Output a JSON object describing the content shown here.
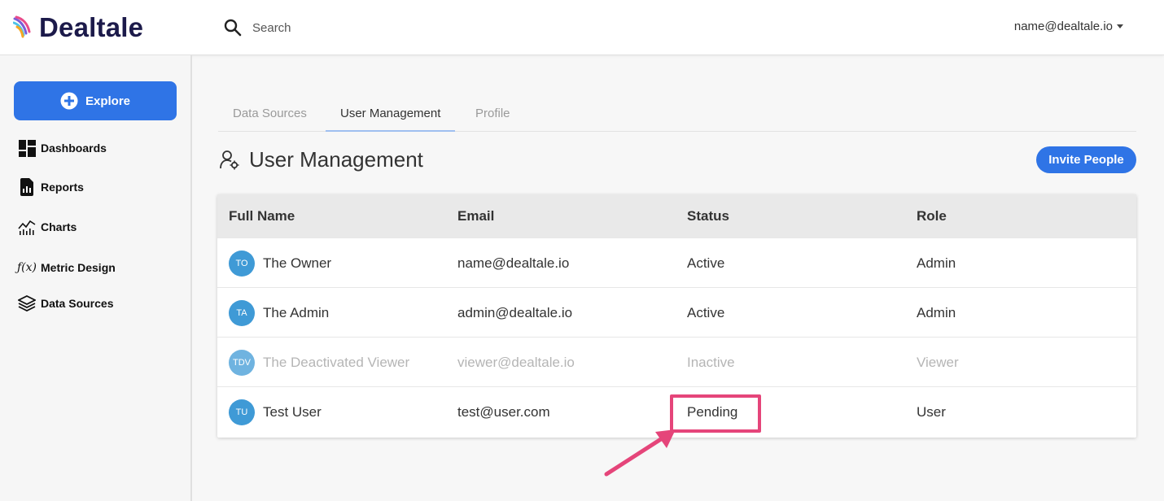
{
  "app": {
    "name": "Dealtale",
    "brand_color": "#1c1a4a",
    "accent": "#2f74e6"
  },
  "header": {
    "search": {
      "placeholder": "Search",
      "icon": "search-icon"
    },
    "user_email": "name@dealtale.io"
  },
  "sidebar": {
    "explore_label": "Explore",
    "items": [
      {
        "label": "Dashboards",
        "icon": "dashboard-icon"
      },
      {
        "label": "Reports",
        "icon": "report-icon"
      },
      {
        "label": "Charts",
        "icon": "chart-icon"
      },
      {
        "label": "Metric Design",
        "icon": "function-icon"
      },
      {
        "label": "Data Sources",
        "icon": "layers-icon"
      }
    ]
  },
  "tabs": [
    {
      "label": "Data Sources",
      "active": false
    },
    {
      "label": "User Management",
      "active": true
    },
    {
      "label": "Profile",
      "active": false
    }
  ],
  "page": {
    "title": "User Management",
    "title_icon": "user-settings-icon",
    "invite_label": "Invite People"
  },
  "table": {
    "columns": [
      "Full Name",
      "Email",
      "Status",
      "Role"
    ],
    "rows": [
      {
        "initials": "TO",
        "name": "The Owner",
        "email": "name@dealtale.io",
        "status": "Active",
        "role": "Admin"
      },
      {
        "initials": "TA",
        "name": "The Admin",
        "email": "admin@dealtale.io",
        "status": "Active",
        "role": "Admin"
      },
      {
        "initials": "TDV",
        "name": "The Deactivated Viewer",
        "email": "viewer@dealtale.io",
        "status": "Inactive",
        "role": "Viewer"
      },
      {
        "initials": "TU",
        "name": "Test User",
        "email": "test@user.com",
        "status": "Pending",
        "role": "User"
      }
    ]
  },
  "annotation": {
    "highlight_color": "#e5457a"
  }
}
